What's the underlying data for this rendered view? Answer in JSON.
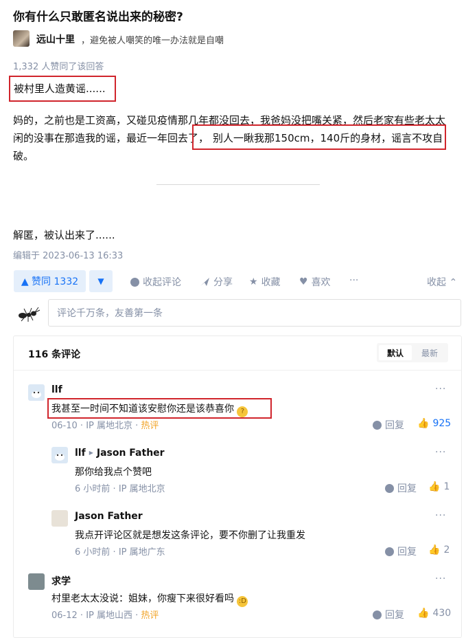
{
  "question": {
    "title": "你有什么只敢匿名说出来的秘密?"
  },
  "author": {
    "name": "远山十里",
    "signature": "，避免被人嘲笑的唯一办法就是自嘲"
  },
  "answer": {
    "vote_line": "1,332 人赞同了该回答",
    "p1": "被村里人造黄谣......",
    "p2_part1": "妈的，之前也是工资高，又碰见疫情那几年都没回去，我爸妈没把嘴关紧，然后老家有些老太太闲的没事在那造我的谣，最近一年回去了，",
    "p2_part2": "别人一瞅我那150cm，140斤的身材，谣言不攻自破。",
    "p3": "解匿，被认出来了......",
    "edited": "编辑于 2023-06-13 16:33"
  },
  "actions": {
    "upvote": "▲ 赞同 1332",
    "downvote": "▼",
    "collapse_comments": "收起评论",
    "share": "分享",
    "favorite": "收藏",
    "like": "喜欢",
    "more": "···",
    "collapse": "收起"
  },
  "comment_input": {
    "placeholder": "评论千万条，友善第一条"
  },
  "comments_panel": {
    "count": "116 条评论",
    "sort_default": "默认",
    "sort_latest": "最新",
    "items": [
      {
        "name": "llf",
        "text": "我甚至一时间不知道该安慰你还是该恭喜你",
        "date": "06-10",
        "ip": "IP 属地北京",
        "hot": "热评",
        "reply": "回复",
        "likes": "925",
        "more": "···"
      },
      {
        "name": "llf",
        "reply_to": "Jason Father",
        "text": "那你给我点个赞吧",
        "date": "6 小时前",
        "ip": "IP 属地北京",
        "reply": "回复",
        "likes": "1",
        "more": "···"
      },
      {
        "name": "Jason Father",
        "text": "我点开评论区就是想发这条评论，要不你删了让我重发",
        "date": "6 小时前",
        "ip": "IP 属地广东",
        "reply": "回复",
        "likes": "2",
        "more": "···"
      },
      {
        "name": "求学",
        "text": "村里老太太没说：姐妹，你瘦下来很好看吗",
        "date": "06-12",
        "ip": "IP 属地山西",
        "hot": "热评",
        "reply": "回复",
        "likes": "430",
        "more": "···"
      }
    ]
  },
  "colors": {
    "accent": "#1772f6",
    "highlight": "#d0242b",
    "muted": "#8590a6",
    "hot": "#f1a429"
  }
}
